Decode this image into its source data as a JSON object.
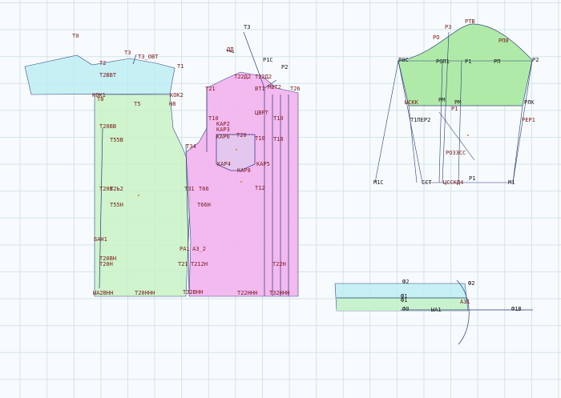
{
  "colors": {
    "sleeve_fill": "#b7ecf2",
    "back_fill": "#c8f2c5",
    "front_fill": "#f2b2ee",
    "sleeve_panel_fill": "#a7e89e",
    "label_color": "#7a1a1a",
    "line_color": "#2a3a7a",
    "point_color": "#e07a1a"
  },
  "labels": {
    "l_t0": "Т0",
    "l_t3": "Т3",
    "l_t3_1": "Т3_ОВТ",
    "l_t2": "Т2",
    "l_t2_1": "Т2ВВТ",
    "l_t1": "Т1",
    "l_kok1": "КОК1",
    "l_t5": "Т5",
    "l_t8": "Т8",
    "l_kok2": "КОК2",
    "l_h8": "Н8",
    "l_t20bb": "Т20ВВ",
    "l_t55b": "Т55В",
    "l_t20b": "Т20В",
    "l_t2_2": "Т2Ь2",
    "l_t55h": "Т55Н",
    "l_ban1": "БАН1",
    "l_t20bh": "Т20ВН",
    "l_t20h": "Т20Н",
    "l_bottom1": "ЫА2ВНН",
    "l_bottom2": "Т20ННН",
    "l_bottom3": "Т32ВНН",
    "l_t3b": "Т3",
    "l_dd": "ДД",
    "l_pic": "Р1С",
    "l_r2": "Р2",
    "l_t22": "Т22Д2",
    "l_t21": "Т21",
    "l_t22b": "Т22Д2",
    "l_t26": "Т26",
    "l_cpq": "ЦВРТ",
    "l_t10": "Т10",
    "l_kap2": "КАР2",
    "l_kap3": "КАР3",
    "l_kap6": "КАР6",
    "l_t20": "Т20",
    "l_kap4": "КАР4",
    "l_kap8": "КАР8",
    "l_kap5": "КАР5",
    "l_t10b": "Т10",
    "l_t10c": "Т10",
    "l_t18": "Т18",
    "l_t3_44": "Т34",
    "l_t31": "Т31",
    "l_t66": "Т66",
    "l_t66h": "Т66Н",
    "l_pa": "РА1",
    "l_pa2": "АЗ_2",
    "l_t21b": "Т21",
    "l_t21h": "Т212Н",
    "l_t22h": "Т22Н",
    "l_t22hh": "Т22ННН",
    "l_t32h": "Т32ННН",
    "l_b1": "ВТ1",
    "l_mbt": "МВТ2",
    "l_t12": "Т12",
    "l_rs0": "Р0С",
    "l_rs1": "РОП1",
    "l_p1": "Р1",
    "l_pn": "РП",
    "l_rs2": "Р2",
    "l_ro": "РО",
    "l_rm": "РМ",
    "l_rv": "РТВ",
    "l_r3": "Р3",
    "l_pro": "РП0",
    "l_rsc": "ЫСКК",
    "l_rw": "РМ",
    "l_rw2": "Р1",
    "l_rlk": "РЛК",
    "l_rper": "Т1ПЕР2",
    "l_rper1": "РЕР1",
    "l_rmb": "М1С",
    "l_rcf": "ССТ",
    "l_rc1": "ЦССКД4",
    "l_m1": "М1",
    "l_rsc2": "РОЗ3СС",
    "l_r1": "Р1",
    "l_w2": "Ф2",
    "l_w2b": "Ф2",
    "l_w1": "Ф1",
    "l_w0": "Ф0",
    "l_wa": "ЫА1",
    "l_wa1": "А31",
    "l_wb": "Ф1В",
    "l_w3": "Ф1"
  }
}
